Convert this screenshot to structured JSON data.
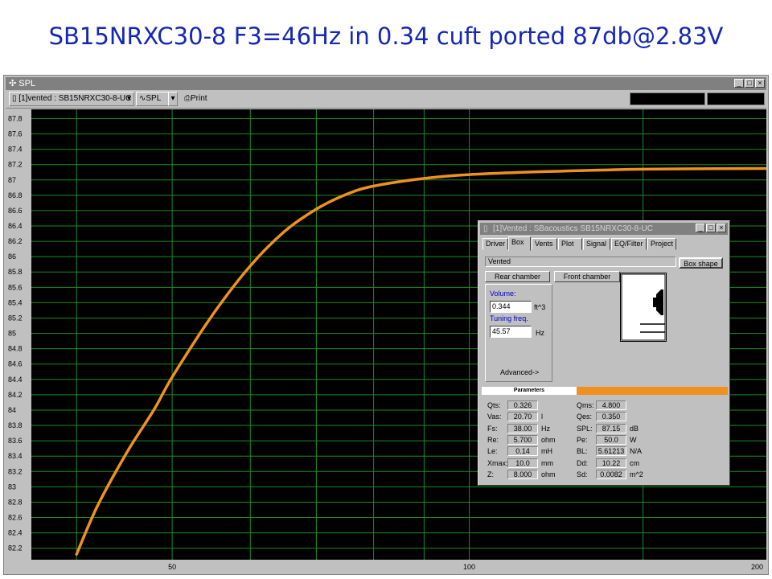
{
  "slide_title": "SB15NRXC30-8  F3=46Hz  in 0.34 cuft ported   87db@2.83V",
  "window": {
    "title": "SPL",
    "toolbar": {
      "driver_select": "[1]vented : SB15NRXC30-8-UC",
      "plot_select": "SPL",
      "print_label": "Print"
    }
  },
  "chart_data": {
    "type": "line",
    "title": "",
    "xlabel": "",
    "ylabel": "",
    "x_scale": "log",
    "xlim": [
      36,
      200
    ],
    "ylim": [
      82.05,
      87.92
    ],
    "grid": true,
    "y_ticks": [
      "87.8",
      "87.6",
      "87.4",
      "87.2",
      "87",
      "86.8",
      "86.6",
      "86.4",
      "86.2",
      "86",
      "85.8",
      "85.6",
      "85.4",
      "85.2",
      "85",
      "84.8",
      "84.6",
      "84.4",
      "84.2",
      "84",
      "83.8",
      "83.6",
      "83.4",
      "83.2",
      "83",
      "82.8",
      "82.6",
      "82.4",
      "82.2"
    ],
    "x_ticks": [
      "50",
      "100",
      "200"
    ],
    "line_color": "#f0901e",
    "series": [
      {
        "x": [
          40,
          42,
          45,
          48,
          50,
          55,
          60,
          65,
          70,
          75,
          80,
          90,
          100,
          120,
          150,
          200
        ],
        "y": [
          82.12,
          82.75,
          83.45,
          84.02,
          84.43,
          85.25,
          85.88,
          86.33,
          86.62,
          86.81,
          86.92,
          87.02,
          87.07,
          87.11,
          87.14,
          87.15
        ]
      }
    ]
  },
  "dialog": {
    "title": "[1]Vented : SBacoustics SB15NRXC30-8-UC",
    "tabs": [
      "Driver",
      "Box",
      "Vents",
      "Plot",
      "Signal",
      "EQ/Filter",
      "Project"
    ],
    "box_type": "Vented",
    "box_shape_button": "Box shape",
    "rear_chamber_button": "Rear chamber",
    "front_chamber_button": "Front chamber",
    "volume_label": "Volume:",
    "volume_value": "0.344",
    "volume_unit": "ft^3",
    "tuning_label": "Tuning freq.",
    "tuning_value": "45.57",
    "tuning_unit": "Hz",
    "advanced_label": "Advanced->",
    "parameters_header": "Parameters",
    "parameters_left": [
      {
        "name": "Qts:",
        "value": "0.326",
        "unit": ""
      },
      {
        "name": "Vas:",
        "value": "20.70",
        "unit": "l"
      },
      {
        "name": "Fs:",
        "value": "38.00",
        "unit": "Hz"
      },
      {
        "name": "Re:",
        "value": "5.700",
        "unit": "ohm"
      },
      {
        "name": "Le:",
        "value": "0.14",
        "unit": "mH"
      },
      {
        "name": "Xmax:",
        "value": "10.0",
        "unit": "mm"
      },
      {
        "name": "Z:",
        "value": "8.000",
        "unit": "ohm"
      }
    ],
    "parameters_right": [
      {
        "name": "Qms:",
        "value": "4.800",
        "unit": ""
      },
      {
        "name": "Qes:",
        "value": "0.350",
        "unit": ""
      },
      {
        "name": "SPL:",
        "value": "87.15",
        "unit": "dB"
      },
      {
        "name": "Pe:",
        "value": "50.0",
        "unit": "W"
      },
      {
        "name": "BL:",
        "value": "5.61213",
        "unit": "N/A"
      },
      {
        "name": "Dd:",
        "value": "10.22",
        "unit": "cm"
      },
      {
        "name": "Sd:",
        "value": "0.0082",
        "unit": "m^2"
      }
    ]
  }
}
